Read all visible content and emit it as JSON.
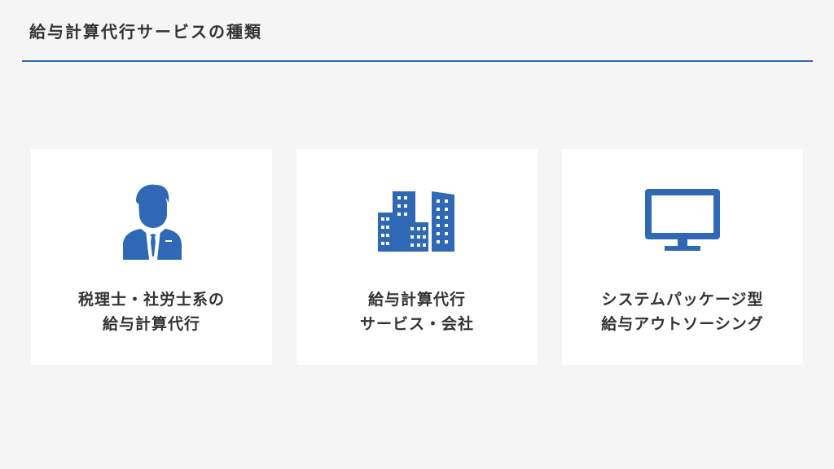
{
  "header": {
    "title": "給与計算代行サービスの種類"
  },
  "colors": {
    "accent": "#2f68b4",
    "background": "#f5f5f5",
    "card": "#ffffff",
    "text": "#333333"
  },
  "cards": [
    {
      "icon": "businessman-icon",
      "line1": "税理士・社労士系の",
      "line2": "給与計算代行"
    },
    {
      "icon": "office-buildings-icon",
      "line1": "給与計算代行",
      "line2": "サービス・会社"
    },
    {
      "icon": "computer-monitor-icon",
      "line1": "システムパッケージ型",
      "line2": "給与アウトソーシング"
    }
  ]
}
